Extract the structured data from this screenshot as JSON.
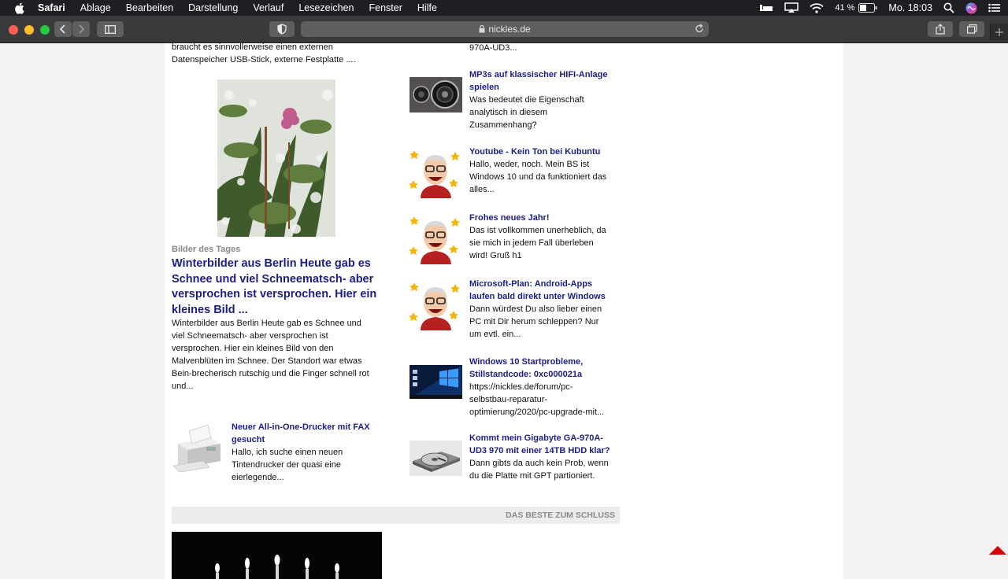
{
  "menubar": {
    "app": "Safari",
    "items": [
      "Ablage",
      "Bearbeiten",
      "Darstellung",
      "Verlauf",
      "Lesezeichen",
      "Fenster",
      "Hilfe"
    ],
    "battery": "41 %",
    "clock": "Mo. 18:03"
  },
  "browser": {
    "url": "nickles.de"
  },
  "left": {
    "top_text": [
      "braucht es sinnvollerweise einen externen",
      "Datenspeicher USB-Stick, externe Festplatte ...."
    ],
    "feature": {
      "category": "Bilder des Tages",
      "title_lines": [
        "Winterbilder aus Berlin Heute gab es",
        "Schnee und viel Schneematsch- aber",
        "versprochen ist versprochen. Hier ein",
        "kleines Bild ..."
      ],
      "body_lines": [
        "Winterbilder aus Berlin Heute gab es Schnee und",
        "viel Schneematsch- aber versprochen ist",
        "versprochen. Hier ein kleines Bild von den",
        "Malvenblüten im Schnee. Der Standort war etwas",
        "Bein-brecherisch rutschig und die Finger schnell rot",
        "und..."
      ]
    },
    "printer": {
      "title_lines": [
        "Neuer All-in-One-Drucker mit FAX",
        "gesucht"
      ],
      "body_lines": [
        "Hallo, ich suche einen neuen",
        "Tintendrucker der quasi eine",
        "eierlegende..."
      ]
    }
  },
  "right": {
    "top_text": "970A-UD3...",
    "items": [
      {
        "thumb": "speaker",
        "title_lines": [
          "MP3s auf klassischer HIFI-Anlage",
          "spielen"
        ],
        "body_lines": [
          "Was bedeutet die Eigenschaft",
          "analytisch in diesem",
          "Zusammenhang?"
        ]
      },
      {
        "thumb": "avatar",
        "title_lines": [
          "Youtube - Kein Ton bei Kubuntu"
        ],
        "body_lines": [
          "Hallo, weder, noch. Mein BS ist",
          "Windows 10 und da funktioniert das",
          "alles..."
        ]
      },
      {
        "thumb": "avatar",
        "title_lines": [
          "Frohes neues Jahr!"
        ],
        "body_lines": [
          "Das ist vollkommen unerheblich, da",
          "sie mich in jedem Fall überleben",
          "wird! Gruß h1"
        ]
      },
      {
        "thumb": "avatar",
        "title_lines": [
          "Microsoft-Plan: Android-Apps",
          "laufen bald direkt unter Windows"
        ],
        "body_lines": [
          "Dann würdest Du also lieber einen",
          "PC mit Dir herum schleppen? Nur",
          "um evtl. ein..."
        ]
      },
      {
        "thumb": "windows",
        "title_lines": [
          "Windows 10 Startprobleme,",
          "Stillstandcode: 0xc000021a"
        ],
        "body_lines": [
          "https://nickles.de/forum/pc-",
          "selbstbau-reparatur-",
          "optimierung/2020/pc-upgrade-mit..."
        ]
      },
      {
        "thumb": "hdd",
        "title_lines": [
          "Kommt mein Gigabyte GA-970A-",
          "UD3 970 mit einer 14TB HDD klar?"
        ],
        "body_lines": [
          "Dann gibts da auch kein Prob, wenn",
          "du die Platte mit GPT partioniert."
        ]
      }
    ]
  },
  "section_banner": "DAS BESTE ZUM SCHLUSS",
  "colors": {
    "link": "#1c1e86",
    "accent_arrow": "#d50000"
  }
}
